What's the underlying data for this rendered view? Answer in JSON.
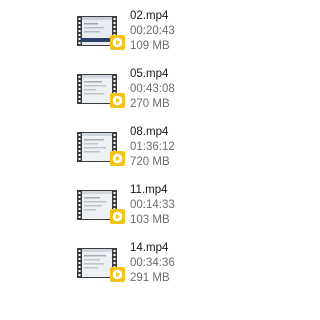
{
  "files": [
    {
      "name": "02.mp4",
      "duration": "00:20:43",
      "size": "109 MB",
      "thumbnail": "video-thumbnail-dark-bar",
      "badge": "play-icon"
    },
    {
      "name": "05.mp4",
      "duration": "00:43:08",
      "size": "270 MB",
      "thumbnail": "video-thumbnail",
      "badge": "play-icon"
    },
    {
      "name": "08.mp4",
      "duration": "01:36:12",
      "size": "720 MB",
      "thumbnail": "video-thumbnail",
      "badge": "play-icon"
    },
    {
      "name": "11.mp4",
      "duration": "00:14:33",
      "size": "103 MB",
      "thumbnail": "video-thumbnail",
      "badge": "play-icon"
    },
    {
      "name": "14.mp4",
      "duration": "00:34:36",
      "size": "291 MB",
      "thumbnail": "video-thumbnail",
      "badge": "play-icon"
    }
  ],
  "colors": {
    "film_strip": "#3c3c3c",
    "badge": "#f2c318",
    "name_text": "#1a1a1a",
    "meta_text": "#6d6d6d"
  }
}
